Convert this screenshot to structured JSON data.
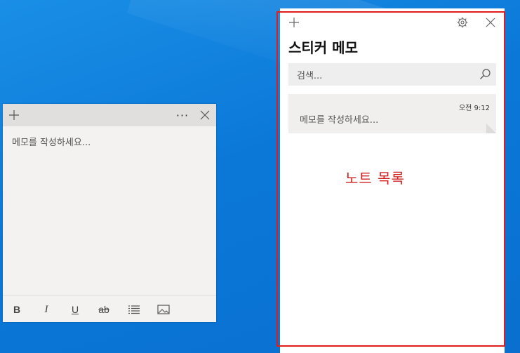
{
  "note_window": {
    "body_placeholder": "메모를 작성하세요...",
    "more_label": "···",
    "toolbar": {
      "bold": "B",
      "italic": "I",
      "underline": "U",
      "strikethrough": "ab"
    }
  },
  "list_panel": {
    "title": "스티커 메모",
    "search": {
      "placeholder": "검색..."
    },
    "notes": [
      {
        "time": "오전 9:12",
        "preview": "메모를 작성하세요..."
      }
    ]
  },
  "annotation": {
    "label": "노트 목록",
    "color": "#e01c1c"
  },
  "colors": {
    "desktop": "#0b78d8",
    "note_background": "#f3f2f1",
    "note_titlebar": "#e1dfdd"
  }
}
